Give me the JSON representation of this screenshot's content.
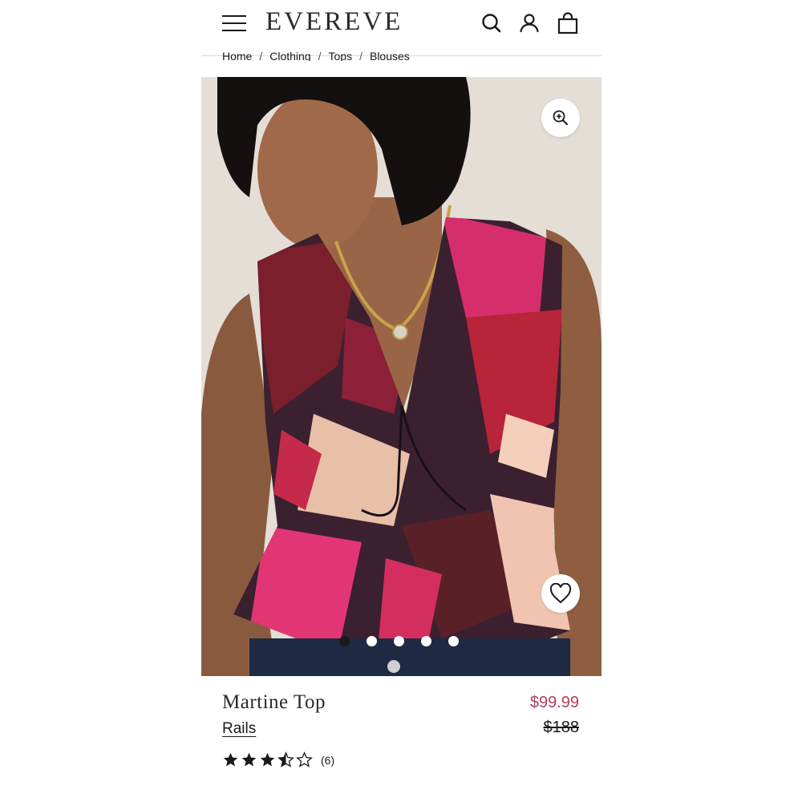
{
  "header": {
    "logo": "EVEREVE",
    "icons": [
      "menu-icon",
      "search-icon",
      "account-icon",
      "bag-icon"
    ]
  },
  "breadcrumb": [
    "Home",
    "Clothing",
    "Tops",
    "Blouses"
  ],
  "breadcrumb_separator": "/",
  "gallery": {
    "image_count": 5,
    "active_index": 0
  },
  "product": {
    "name": "Martine Top",
    "brand": "Rails",
    "sale_price": "$99.99",
    "original_price": "$188",
    "rating": 3.5,
    "rating_max": 5,
    "review_count": "(6)"
  },
  "colors": {
    "sale": "#b43c5c",
    "text": "#1a1a1a"
  }
}
